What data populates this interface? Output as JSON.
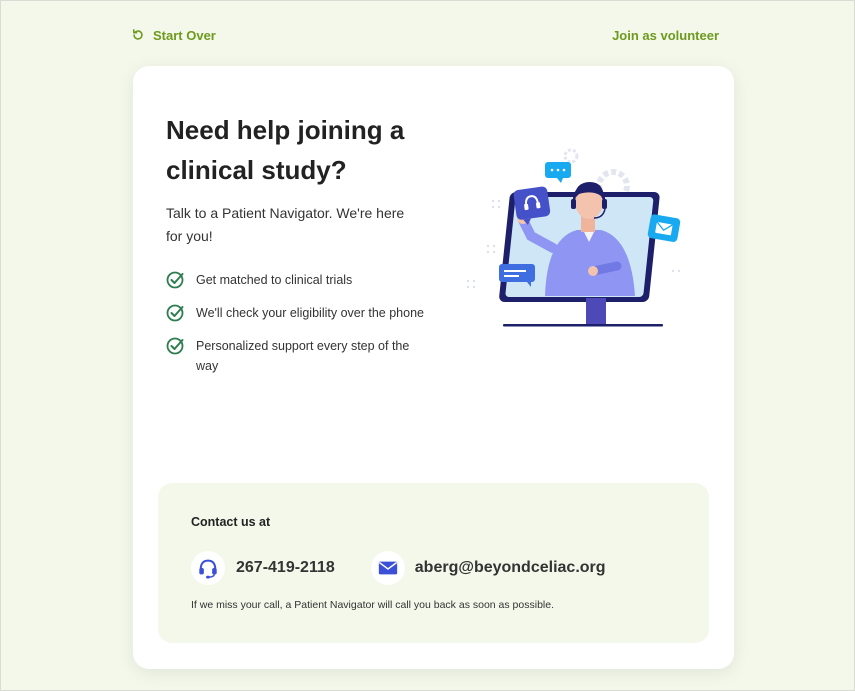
{
  "nav": {
    "start_over": "Start Over",
    "join": "Join as volunteer"
  },
  "hero": {
    "headline": "Need help joining a clinical study?",
    "subtext": "Talk to a Patient Navigator. We're here for you!"
  },
  "benefits": [
    "Get matched to clinical trials",
    "We'll check your eligibility over the phone",
    "Personalized support every step of the way"
  ],
  "contact": {
    "title": "Contact us at",
    "phone": "267-419-2118",
    "email": "aberg@beyondceliac.org",
    "note": "If we miss your call, a Patient Navigator will call you back as soon as possible."
  },
  "colors": {
    "accent_green": "#6e9a1e",
    "check_green": "#2e7d4f",
    "icon_blue": "#3b4fd8",
    "background": "#f3f8ea"
  },
  "icons": {
    "start_over": "refresh-icon",
    "check": "check-circle-icon",
    "phone": "headset-icon",
    "email": "mail-icon"
  }
}
